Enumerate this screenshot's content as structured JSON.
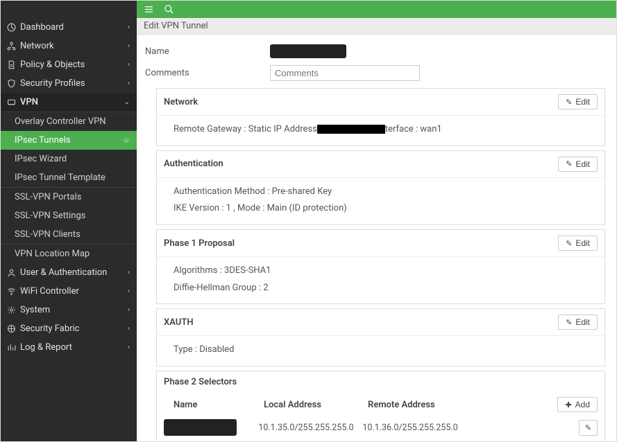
{
  "sidebar": {
    "items": [
      {
        "icon": "dashboard",
        "label": "Dashboard",
        "chev": ">"
      },
      {
        "icon": "network",
        "label": "Network",
        "chev": ">"
      },
      {
        "icon": "policy",
        "label": "Policy & Objects",
        "chev": ">"
      },
      {
        "icon": "security",
        "label": "Security Profiles",
        "chev": ">"
      },
      {
        "icon": "vpn",
        "label": "VPN",
        "chev": "v",
        "expanded": true,
        "sub": [
          {
            "label": "Overlay Controller VPN"
          },
          {
            "label": "IPsec Tunnels",
            "active": true,
            "star": true
          },
          {
            "label": "IPsec Wizard"
          },
          {
            "label": "IPsec Tunnel Template"
          },
          {
            "divider": true
          },
          {
            "label": "SSL-VPN Portals"
          },
          {
            "label": "SSL-VPN Settings"
          },
          {
            "label": "SSL-VPN Clients"
          },
          {
            "divider": true
          },
          {
            "label": "VPN Location Map"
          }
        ]
      },
      {
        "icon": "user",
        "label": "User & Authentication",
        "chev": ">"
      },
      {
        "icon": "wifi",
        "label": "WiFi Controller",
        "chev": ">"
      },
      {
        "icon": "system",
        "label": "System",
        "chev": ">"
      },
      {
        "icon": "fabric",
        "label": "Security Fabric",
        "chev": ">"
      },
      {
        "icon": "log",
        "label": "Log & Report",
        "chev": ">"
      }
    ]
  },
  "page": {
    "breadcrumb": "Edit VPN Tunnel",
    "name_label": "Name",
    "comments_label": "Comments",
    "comments_placeholder": "Comments"
  },
  "panels": {
    "network": {
      "title": "Network",
      "edit": "Edit",
      "line_pre": "Remote Gateway : Static IP Address",
      "line_post": "terface : wan1"
    },
    "auth": {
      "title": "Authentication",
      "edit": "Edit",
      "l1": "Authentication Method : Pre-shared Key",
      "l2": "IKE Version : 1 , Mode : Main (ID protection)"
    },
    "phase1": {
      "title": "Phase 1 Proposal",
      "edit": "Edit",
      "l1": "Algorithms : 3DES-SHA1",
      "l2": "Diffie-Hellman Group : 2"
    },
    "xauth": {
      "title": "XAUTH",
      "edit": "Edit",
      "l1": "Type : Disabled"
    },
    "phase2": {
      "title": "Phase 2 Selectors",
      "cols": {
        "name": "Name",
        "local": "Local Address",
        "remote": "Remote Address"
      },
      "add": "Add",
      "row": {
        "local": "10.1.35.0/255.255.255.0",
        "remote": "10.1.36.0/255.255.255.0"
      }
    }
  },
  "icons": {
    "pencil": "✎",
    "plus": "✚",
    "star": "☆",
    "chev_right": "›",
    "chev_down": "⌄"
  }
}
